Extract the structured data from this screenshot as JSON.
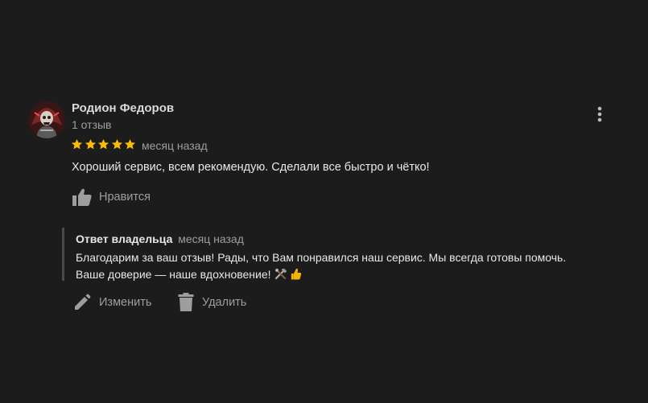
{
  "review": {
    "author_name": "Родион Федоров",
    "review_count": "1 отзыв",
    "rating": 5,
    "rating_max": 5,
    "date": "месяц назад",
    "text": "Хороший сервис, всем рекомендую. Сделали все быстро и чётко!",
    "like_label": "Нравится",
    "menu_icon": "more-vertical-icon"
  },
  "owner_reply": {
    "title": "Ответ владельца",
    "date": "месяц назад",
    "line1": "Благодарим за ваш отзыв! Рады, что Вам понравился наш сервис. Мы всегда готовы помочь.",
    "line2": "Ваше доверие — наше вдохновение!",
    "emojis": [
      "hammer-and-wrench-icon",
      "thumbs-up-icon"
    ]
  },
  "actions": {
    "edit_label": "Изменить",
    "delete_label": "Удалить"
  },
  "colors": {
    "background": "#1c1c1c",
    "star": "#fbbc04",
    "muted_text": "#9e9e9e",
    "primary_text": "#e8e8e8"
  }
}
